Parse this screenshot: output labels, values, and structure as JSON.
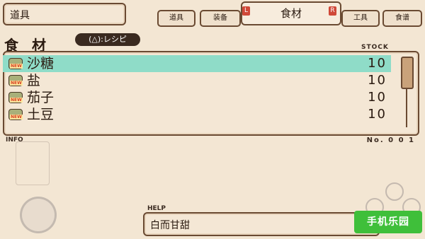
{
  "top": {
    "category": "道具",
    "tabs": [
      "道具",
      "装备",
      "食材",
      "工具",
      "食谱"
    ],
    "active_tab": "食材",
    "l_badge": "L",
    "r_badge": "R"
  },
  "list": {
    "title": "食 材",
    "recipe_button": "(△):レシピ",
    "stock_header": "STOCK",
    "items": [
      {
        "name": "沙糖",
        "qty": "10",
        "badge": "NEW"
      },
      {
        "name": "盐",
        "qty": "10",
        "badge": "NEW"
      },
      {
        "name": "茄子",
        "qty": "10",
        "badge": "NEW"
      },
      {
        "name": "土豆",
        "qty": "10",
        "badge": "NEW"
      }
    ]
  },
  "info": {
    "label": "INFO",
    "number": "No. 0 0 1"
  },
  "help": {
    "label": "HELP",
    "text": "白而甘甜"
  },
  "watermark": "手机乐园",
  "colors": {
    "selection": "#8fdcc8",
    "border": "#6a4a32",
    "panel": "#f4e7d5"
  }
}
